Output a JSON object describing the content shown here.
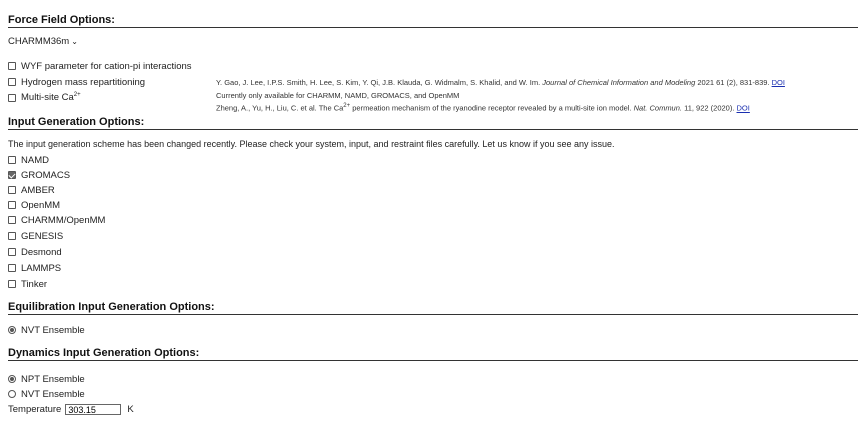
{
  "force_field": {
    "title": "Force Field Options:",
    "selected": "CHARMM36m",
    "options": [
      {
        "label": "WYF parameter for cation-pi interactions",
        "checked": false
      },
      {
        "label": "Hydrogen mass repartitioning",
        "checked": false
      },
      {
        "label": "Multi-site Ca",
        "sup": "2+",
        "checked": false
      }
    ],
    "refs": {
      "hmr_ref": "Y. Gao, J. Lee, I.P.S. Smith, H. Lee, S. Kim, Y. Qi, J.B. Klauda, G. Widmalm, S. Khalid, and W. Im.",
      "hmr_journal": "Journal of Chemical Information and Modeling",
      "hmr_tail": "2021 61 (2), 831-839.",
      "hmr_doi": "DOI",
      "hmr_note": "Currently only available for CHARMM, NAMD, GROMACS, and OpenMM",
      "ca_ref_a": "Zheng, A., Yu, H., Liu, C. et al. The Ca",
      "ca_sup": "2+",
      "ca_ref_b": " permeation mechanism of the ryanodine receptor revealed by a multi-site ion model.",
      "ca_journal": "Nat. Commun.",
      "ca_tail": "11, 922 (2020).",
      "ca_doi": "DOI"
    }
  },
  "input_generation": {
    "title": "Input Generation Options:",
    "note": "The input generation scheme has been changed recently. Please check your system, input, and restraint files carefully. Let us know if you see any issue.",
    "programs": [
      {
        "label": "NAMD",
        "checked": false
      },
      {
        "label": "GROMACS",
        "checked": true
      },
      {
        "label": "AMBER",
        "checked": false
      },
      {
        "label": "OpenMM",
        "checked": false
      },
      {
        "label": "CHARMM/OpenMM",
        "checked": false
      },
      {
        "label": "GENESIS",
        "checked": false
      },
      {
        "label": "Desmond",
        "checked": false
      },
      {
        "label": "LAMMPS",
        "checked": false
      },
      {
        "label": "Tinker",
        "checked": false
      }
    ]
  },
  "equilibration": {
    "title": "Equilibration Input Generation Options:",
    "options": [
      {
        "label": "NVT Ensemble",
        "checked": true
      }
    ]
  },
  "dynamics": {
    "title": "Dynamics Input Generation Options:",
    "options": [
      {
        "label": "NPT Ensemble",
        "checked": true
      },
      {
        "label": "NVT Ensemble",
        "checked": false
      }
    ],
    "temperature_label": "Temperature",
    "temperature_value": "303.15",
    "temperature_unit": "K"
  }
}
